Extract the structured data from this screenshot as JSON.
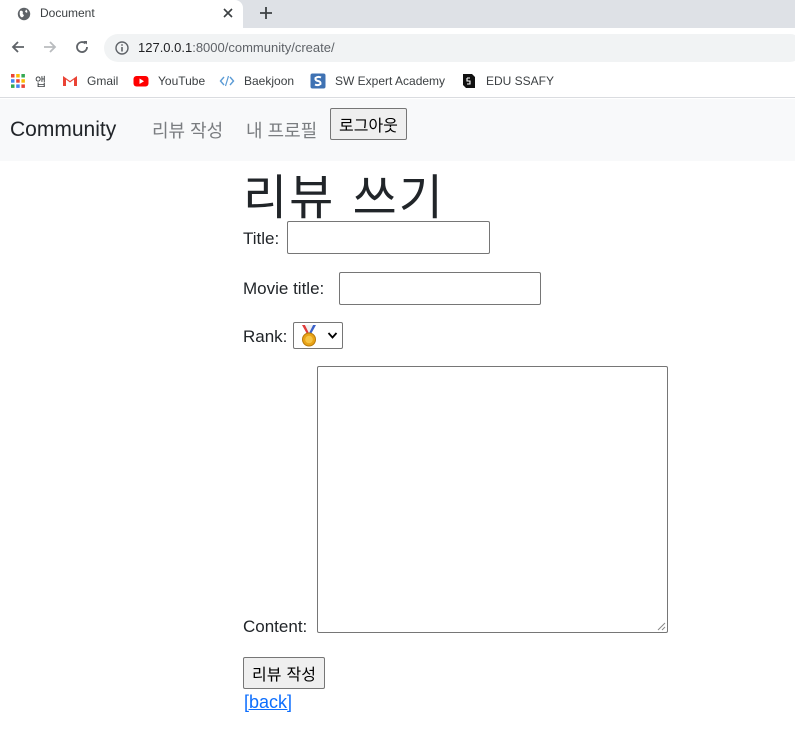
{
  "browser": {
    "tab_title": "Document",
    "url_host": "127.0.0.1",
    "url_rest": ":8000/community/create/",
    "bookmarks": [
      {
        "label": "앱",
        "icon": "apps-grid-icon"
      },
      {
        "label": "Gmail",
        "icon": "gmail-icon"
      },
      {
        "label": "YouTube",
        "icon": "youtube-icon"
      },
      {
        "label": "Baekjoon",
        "icon": "code-brackets-icon"
      },
      {
        "label": "SW Expert Academy",
        "icon": "sw-expert-icon"
      },
      {
        "label": "EDU SSAFY",
        "icon": "edu-ssafy-icon"
      }
    ]
  },
  "navbar": {
    "brand": "Community",
    "links": [
      "리뷰 작성",
      "내 프로필"
    ],
    "logout_label": "로그아웃"
  },
  "form": {
    "heading": "리뷰 쓰기",
    "title_label": "Title:",
    "title_value": "",
    "movie_title_label": "Movie title:",
    "movie_title_value": "",
    "rank_label": "Rank:",
    "rank_selected": "medal-icon",
    "content_label": "Content:",
    "content_value": "",
    "submit_label": "리뷰 작성",
    "back_label": "[back]"
  },
  "colors": {
    "navbar_bg": "#f8f9fa",
    "link": "#0d6efd",
    "nav_link": "#7a7d80"
  }
}
